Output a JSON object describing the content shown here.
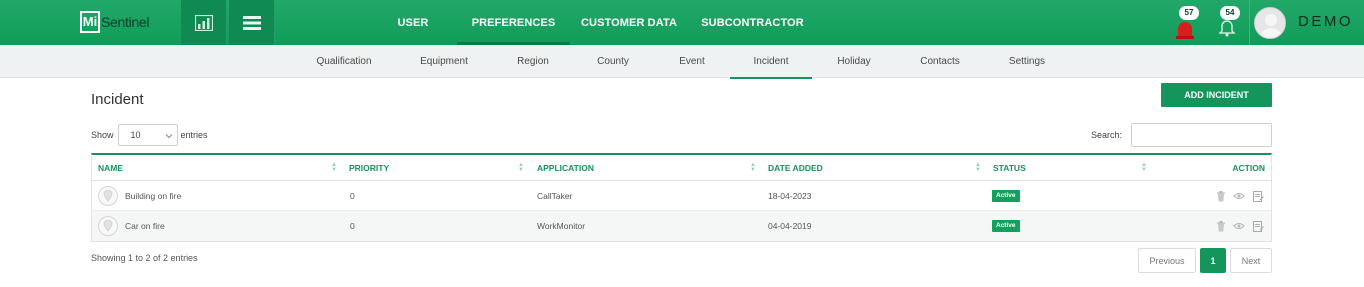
{
  "app": {
    "logo_mark": "Mi",
    "logo_text": "Sentinel",
    "user_name": "DEMO"
  },
  "topnav": [
    {
      "label": "USER"
    },
    {
      "label": "PREFERENCES",
      "active": true
    },
    {
      "label": "CUSTOMER DATA"
    },
    {
      "label": "SUBCONTRACTOR"
    }
  ],
  "notifications": {
    "alarm_count": "57",
    "bell_count": "54"
  },
  "subnav": [
    {
      "label": "Qualification"
    },
    {
      "label": "Equipment"
    },
    {
      "label": "Region"
    },
    {
      "label": "County"
    },
    {
      "label": "Event"
    },
    {
      "label": "Incident",
      "active": true
    },
    {
      "label": "Holiday"
    },
    {
      "label": "Contacts"
    },
    {
      "label": "Settings"
    }
  ],
  "page": {
    "title": "Incident",
    "add_button": "ADD INCIDENT",
    "show_label": "Show",
    "entries_value": "10",
    "entries_label": "entries",
    "search_label": "Search:",
    "search_value": ""
  },
  "table": {
    "columns": [
      "NAME",
      "PRIORITY",
      "APPLICATION",
      "DATE ADDED",
      "STATUS",
      "ACTION"
    ],
    "rows": [
      {
        "name": "Building on fire",
        "priority": "0",
        "application": "CallTaker",
        "date_added": "18-04-2023",
        "status": "Active"
      },
      {
        "name": "Car on fire",
        "priority": "0",
        "application": "WorkMonitor",
        "date_added": "04-04-2019",
        "status": "Active"
      }
    ]
  },
  "footer": {
    "info": "Showing 1 to 2 of 2 entries",
    "previous": "Previous",
    "current_page": "1",
    "next": "Next"
  },
  "colors": {
    "brand_green": "#13955c",
    "alarm_red": "#e02020"
  }
}
